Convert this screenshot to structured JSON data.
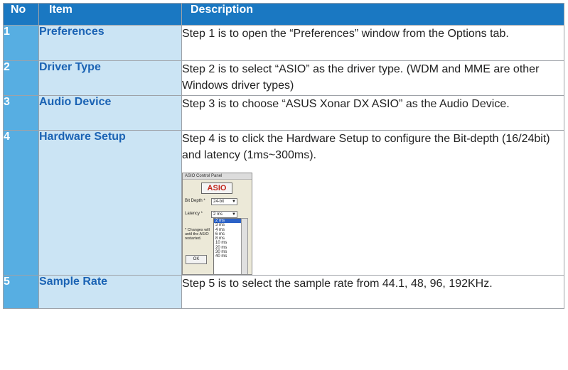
{
  "header": {
    "no": "No",
    "item": "Item",
    "description": "Description"
  },
  "rows": [
    {
      "no": "1",
      "item": "Preferences",
      "desc": "Step 1 is to open the “Preferences” window from the Options tab."
    },
    {
      "no": "2",
      "item": "Driver Type",
      "desc": "Step 2 is to select “ASIO” as the driver type. (WDM and MME are other Windows driver types)"
    },
    {
      "no": "3",
      "item": "Audio Device",
      "desc": "Step 3 is to choose “ASUS Xonar DX ASIO” as the Audio Device."
    },
    {
      "no": "4",
      "item": "Hardware Setup",
      "desc": "Step 4 is to click the Hardware Setup to configure the Bit-depth (16/24bit) and latency (1ms~300ms)."
    },
    {
      "no": "5",
      "item": "Sample Rate",
      "desc": "Step 5 is to select the sample rate from 44.1, 48, 96, 192KHz."
    }
  ],
  "asio_panel": {
    "title": "ASIO Control Panel",
    "logo": "ASIO",
    "bit_depth_label": "Bit Depth *",
    "bit_depth_value": "24-bit",
    "latency_label": "Latency *",
    "latency_value": "2 ms",
    "latency_options": [
      "2 ms",
      "3 ms",
      "4 ms",
      "6 ms",
      "8 ms",
      "10 ms",
      "20 ms",
      "30 ms",
      "40 ms"
    ],
    "note": "* Changes will until the ASIO restarted.",
    "ok_label": "OK"
  },
  "colors": {
    "header_bg": "#1a78c2",
    "no_bg": "#57aee2",
    "item_bg": "#cbe4f4",
    "item_text": "#1b63b4"
  }
}
